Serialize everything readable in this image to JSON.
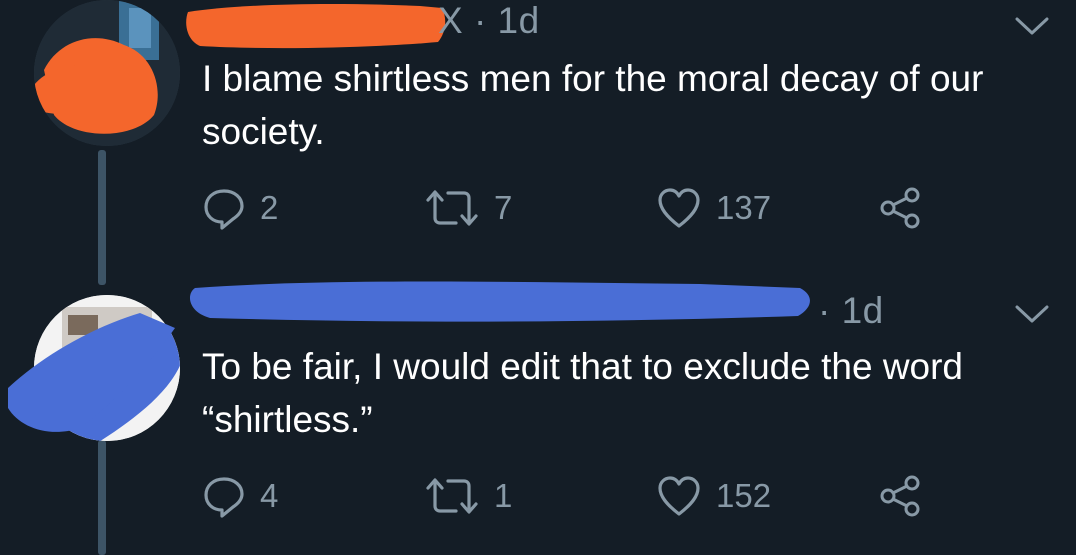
{
  "tweets": [
    {
      "meta": "X · 1d",
      "text": "I blame shirtless men for the moral decay of our society.",
      "replies": "2",
      "retweets": "7",
      "likes": "137",
      "author_redaction_color": "#f4662c"
    },
    {
      "meta": "· 1d",
      "text": "To be fair, I would edit that to exclude the word “shirtless.”",
      "replies": "4",
      "retweets": "1",
      "likes": "152",
      "author_redaction_color": "#4a6ed6"
    }
  ],
  "icons": {
    "more": "chevron-down-icon",
    "reply": "reply-bubble-icon",
    "retweet": "retweet-icon",
    "like": "heart-icon",
    "share": "share-icon"
  },
  "colors": {
    "background": "#141d26",
    "muted_text": "#8899a6",
    "thread_line": "#3d5466"
  }
}
